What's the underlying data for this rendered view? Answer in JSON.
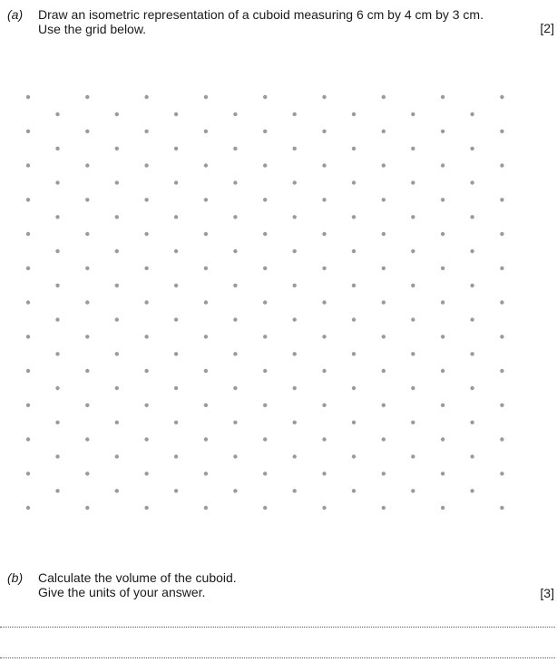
{
  "part_a": {
    "label": "(a)",
    "line1": "Draw an isometric representation of a cuboid measuring 6 cm by 4 cm by 3 cm.",
    "line2": "Use the grid below.",
    "marks": "[2]"
  },
  "part_b": {
    "label": "(b)",
    "line1": "Calculate the volume of the cuboid.",
    "line2": "Give the units of your answer.",
    "marks": "[3]"
  },
  "grid": {
    "type": "isometric dot grid",
    "dot_color": "#9a9a9a"
  }
}
